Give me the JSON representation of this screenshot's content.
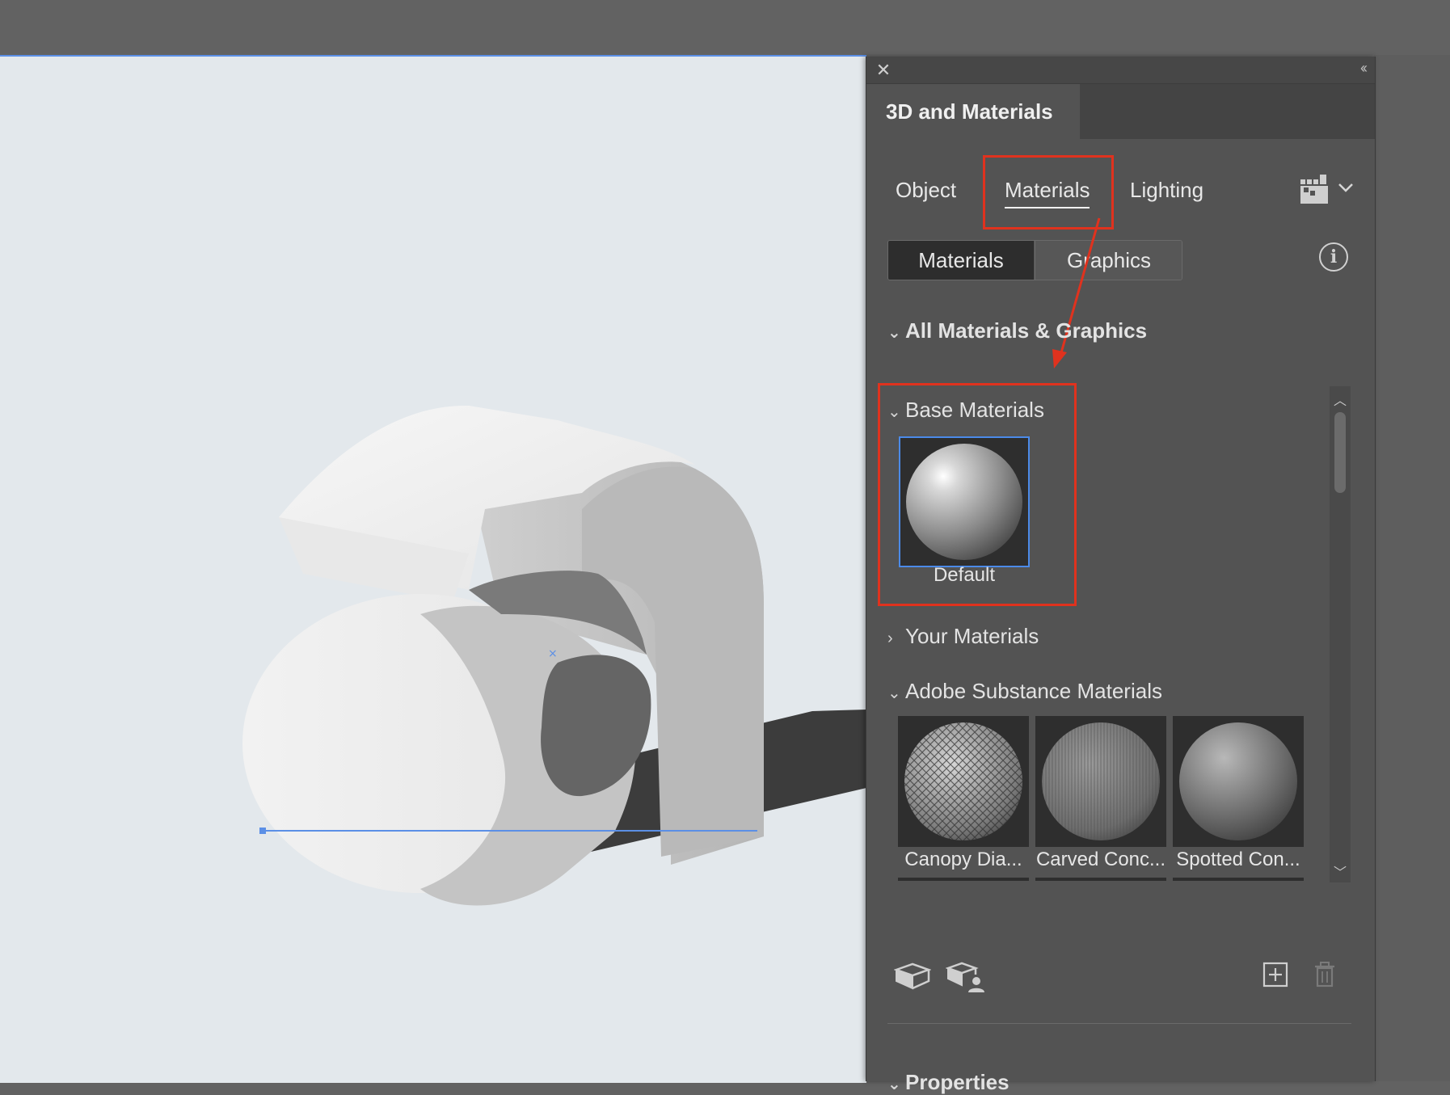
{
  "panel": {
    "close_glyph": "✕",
    "collapse_glyph": "‹‹",
    "title": "3D and Materials",
    "tabs": [
      {
        "label": "Object"
      },
      {
        "label": "Materials"
      },
      {
        "label": "Lighting"
      }
    ],
    "segmented": [
      {
        "label": "Materials"
      },
      {
        "label": "Graphics"
      }
    ],
    "sections": {
      "all": "All Materials & Graphics",
      "base": "Base Materials",
      "yours": "Your Materials",
      "substance": "Adobe Substance Materials",
      "properties": "Properties"
    },
    "base_materials": [
      {
        "label": "Default"
      }
    ],
    "substance_materials": [
      {
        "label": "Canopy Dia..."
      },
      {
        "label": "Carved Conc..."
      },
      {
        "label": "Spotted Con..."
      }
    ]
  },
  "colors": {
    "highlight": "#e0321e",
    "selection": "#4b8ae8",
    "panel_bg": "#535353",
    "canvas_bg": "#e3e8ec"
  },
  "icons": {
    "close": "close-icon",
    "collapse": "collapse-panel-icon",
    "render_settings": "render-settings-icon",
    "info": "info-icon",
    "place_material": "cube-icon",
    "place_graphic": "cube-user-icon",
    "add": "add-icon",
    "delete": "trash-icon"
  }
}
